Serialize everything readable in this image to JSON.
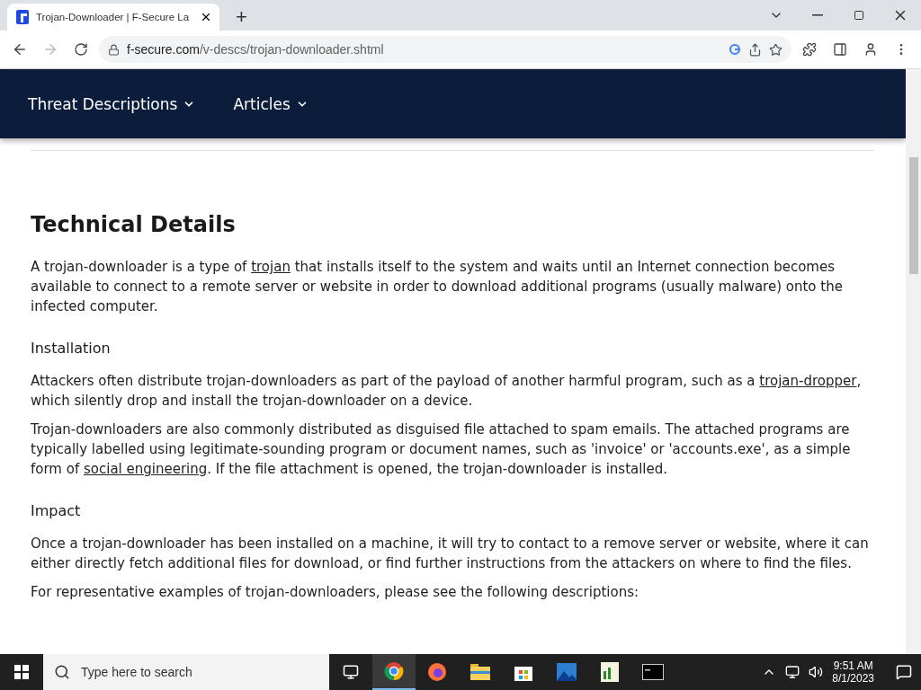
{
  "browser": {
    "tab_title": "Trojan-Downloader | F-Secure La",
    "new_tab": "+",
    "url_host": "f-secure.com",
    "url_path": "/v-descs/trojan-downloader.shtml"
  },
  "nav": {
    "items": [
      "Threat Descriptions",
      "Articles"
    ]
  },
  "article": {
    "title": "Technical Details",
    "intro": [
      {
        "kind": "text",
        "text": "A trojan-downloader is a type of "
      },
      {
        "kind": "link",
        "text": "trojan"
      },
      {
        "kind": "text",
        "text": " that installs itself to the system and waits until an Internet connection becomes available to connect to a remote server or website in order to download additional programs (usually malware) onto the infected computer."
      }
    ],
    "sections": [
      {
        "heading": "Installation",
        "paragraphs": [
          [
            {
              "kind": "text",
              "text": "Attackers often distribute trojan-downloaders as part of the payload of another harmful program, such as a "
            },
            {
              "kind": "link",
              "text": "trojan-dropper"
            },
            {
              "kind": "text",
              "text": ", which silently drop and install the trojan-downloader on a device."
            }
          ],
          [
            {
              "kind": "text",
              "text": "Trojan-downloaders are also commonly distributed as disguised file attached to spam emails. The attached programs are typically labelled using legitimate-sounding program or document names, such as 'invoice' or 'accounts.exe', as a simple form of "
            },
            {
              "kind": "link",
              "text": "social engineering"
            },
            {
              "kind": "text",
              "text": ". If the file attachment is opened, the trojan-downloader is installed."
            }
          ]
        ]
      },
      {
        "heading": "Impact",
        "paragraphs": [
          [
            {
              "kind": "text",
              "text": "Once a trojan-downloader has been installed on a machine, it will try to contact to a remove server or website, where it can either directly fetch additional files for download, or find further instructions from the attackers on where to find the files."
            }
          ],
          [
            {
              "kind": "text",
              "text": "For representative examples of trojan-downloaders, please see the following descriptions:"
            }
          ]
        ]
      }
    ]
  },
  "taskbar": {
    "search_placeholder": "Type here to search",
    "time": "9:51 AM",
    "date": "8/1/2023"
  }
}
